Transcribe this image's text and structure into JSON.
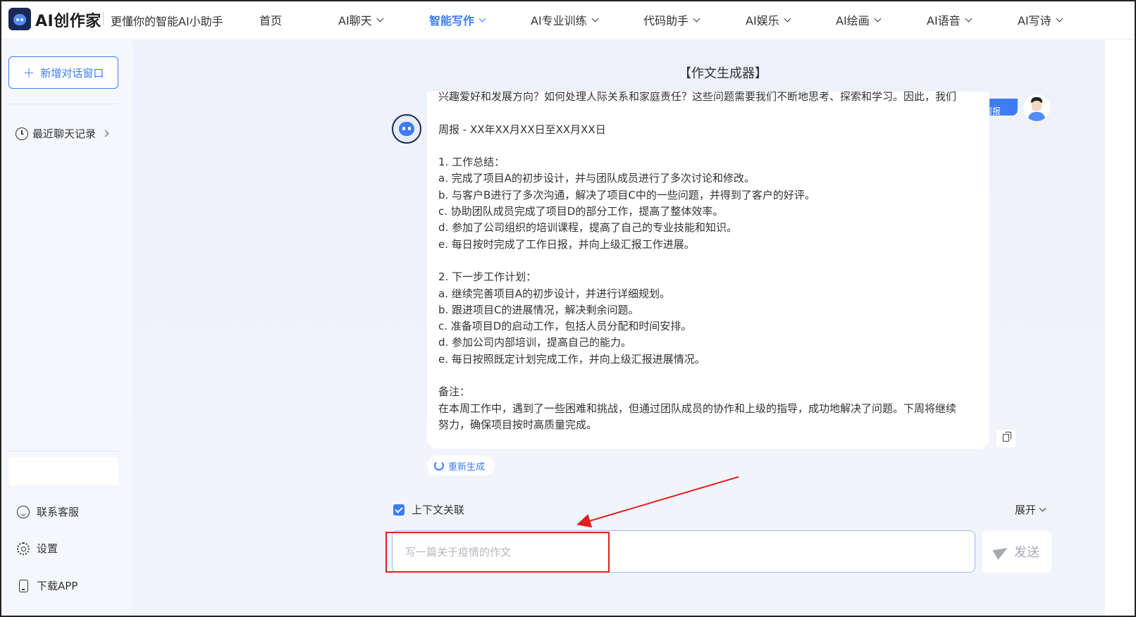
{
  "header": {
    "brand": "AI创作家",
    "tagline": "更懂你的智能AI小助手",
    "nav": [
      {
        "label": "首页",
        "has_dropdown": false,
        "active": false
      },
      {
        "label": "AI聊天",
        "has_dropdown": true,
        "active": false
      },
      {
        "label": "智能写作",
        "has_dropdown": true,
        "active": true
      },
      {
        "label": "AI专业训练",
        "has_dropdown": true,
        "active": false
      },
      {
        "label": "代码助手",
        "has_dropdown": true,
        "active": false
      },
      {
        "label": "AI娱乐",
        "has_dropdown": true,
        "active": false
      },
      {
        "label": "AI绘画",
        "has_dropdown": true,
        "active": false
      },
      {
        "label": "AI语音",
        "has_dropdown": true,
        "active": false
      },
      {
        "label": "AI写诗",
        "has_dropdown": true,
        "active": false
      }
    ]
  },
  "sidebar": {
    "new_chat_label": "新增对话窗口",
    "recent_label": "最近聊天记录",
    "footer": [
      {
        "label": "联系客服",
        "icon": "customer-service-icon"
      },
      {
        "label": "设置",
        "icon": "gear-icon"
      },
      {
        "label": "下载APP",
        "icon": "phone-icon"
      }
    ]
  },
  "main": {
    "title": "【作文生成器】",
    "user_message": "周报",
    "reply_text": "兴趣爱好和发展方向？如何处理人际关系和家庭责任？这些问题需要我们不断地思考、探索和学习。因此，我们\n\n周报 - XX年XX月XX日至XX月XX日\n\n1. 工作总结：\na. 完成了项目A的初步设计，并与团队成员进行了多次讨论和修改。\nb. 与客户B进行了多次沟通，解决了项目C中的一些问题，并得到了客户的好评。\nc. 协助团队成员完成了项目D的部分工作，提高了整体效率。\nd. 参加了公司组织的培训课程，提高了自己的专业技能和知识。\ne. 每日按时完成了工作日报，并向上级汇报工作进展。\n\n2. 下一步工作计划：\na. 继续完善项目A的初步设计，并进行详细规划。\nb. 跟进项目C的进展情况，解决剩余问题。\nc. 准备项目D的启动工作，包括人员分配和时间安排。\nd. 参加公司内部培训，提高自己的能力。\ne. 每日按照既定计划完成工作，并向上级汇报进展情况。\n\n备注：\n在本周工作中，遇到了一些困难和挑战，但通过团队成员的协作和上级的指导，成功地解决了问题。下周将继续\n努力，确保项目按时高质量完成。",
    "regenerate_label": "重新生成",
    "context_label": "上下文关联",
    "context_checked": true,
    "expand_label": "展开",
    "input_placeholder": "写一篇关于疫情的作文",
    "input_value": "",
    "send_label": "发送"
  },
  "colors": {
    "accent": "#3d7cf5",
    "annotation": "#e02020"
  }
}
